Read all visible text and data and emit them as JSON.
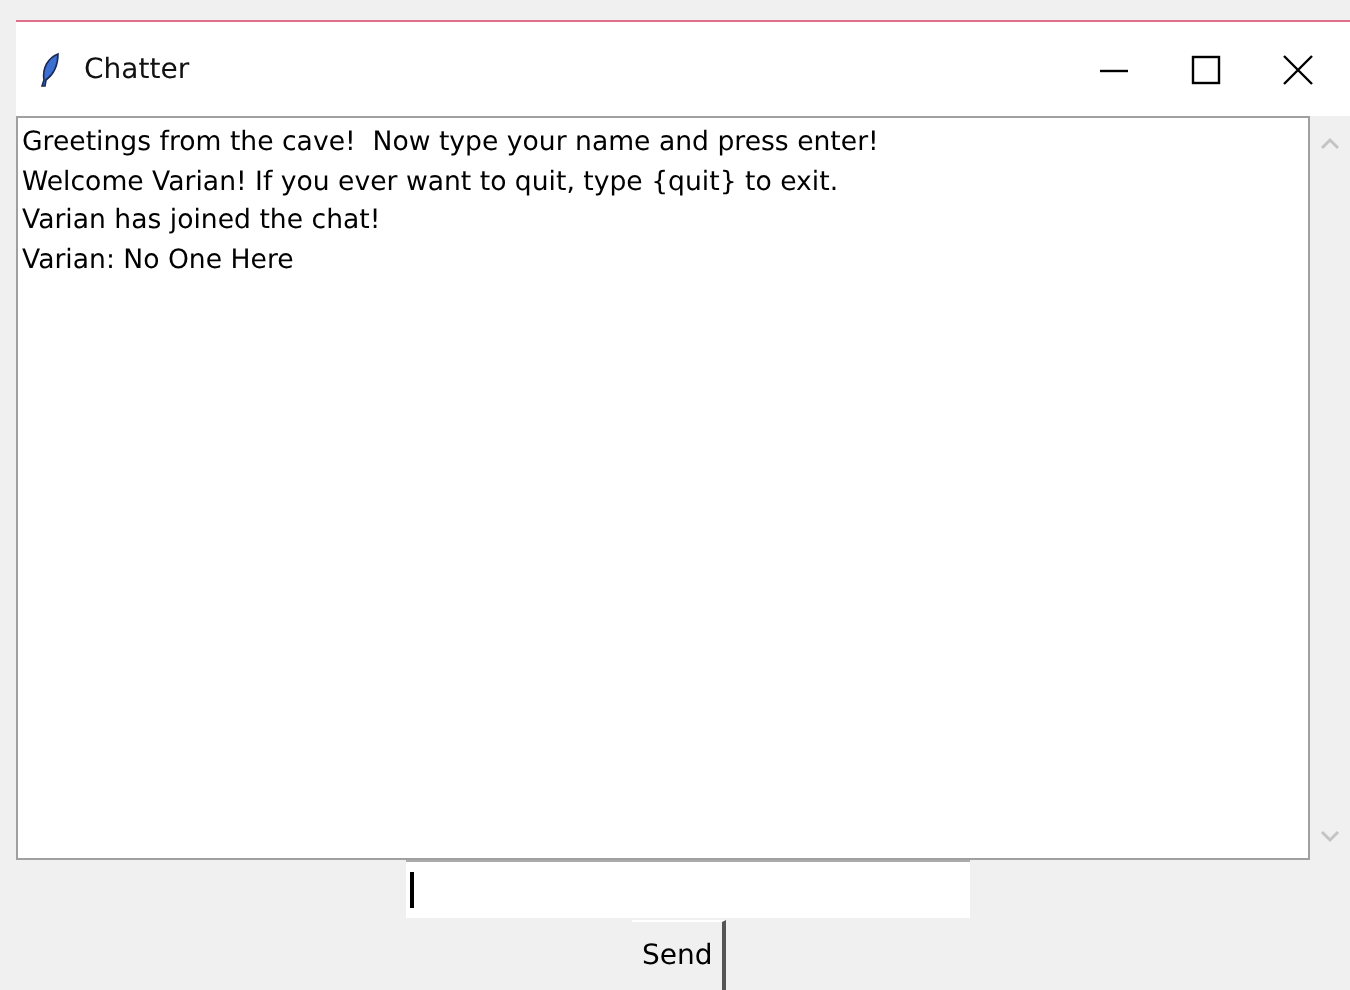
{
  "window": {
    "title": "Chatter"
  },
  "messages": [
    "Greetings from the cave!  Now type your name and press enter!",
    "Welcome Varian! If you ever want to quit, type {quit} to exit.",
    "Varian has joined the chat!",
    "Varian: No One Here"
  ],
  "send_button": "Send"
}
